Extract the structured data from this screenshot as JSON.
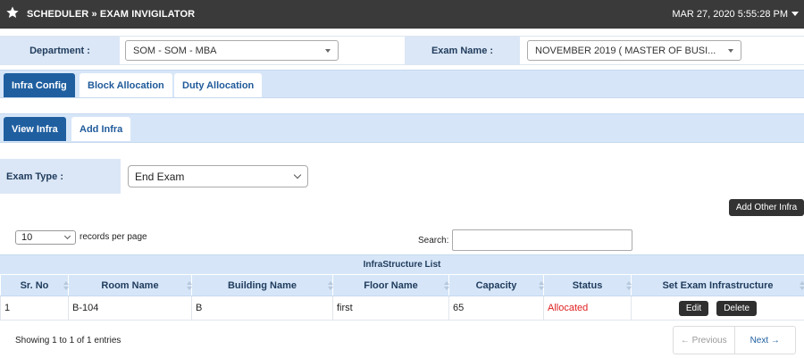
{
  "header": {
    "icon": "star-icon",
    "title": "SCHEDULER » EXAM INVIGILATOR",
    "datetime": "MAR 27, 2020   5:55:28 PM"
  },
  "filters": {
    "department_label": "Department :",
    "department_value": "SOM - SOM - MBA",
    "exam_name_label": "Exam Name :",
    "exam_name_value": "NOVEMBER 2019 ( MASTER OF BUSI..."
  },
  "main_tabs": [
    {
      "label": "Infra Config",
      "active": true
    },
    {
      "label": "Block Allocation",
      "active": false
    },
    {
      "label": "Duty Allocation",
      "active": false
    }
  ],
  "sub_tabs": [
    {
      "label": "View Infra",
      "active": true
    },
    {
      "label": "Add Infra",
      "active": false
    }
  ],
  "exam_type": {
    "label": "Exam Type :",
    "value": "End Exam"
  },
  "add_other_label": "Add Other Infra",
  "table_controls": {
    "page_length": "10",
    "page_length_suffix": "records per page",
    "search_label": "Search:",
    "search_value": ""
  },
  "table": {
    "caption": "InfraStructure List",
    "columns": [
      "Sr. No",
      "Room Name",
      "Building Name",
      "Floor Name",
      "Capacity",
      "Status",
      "Set Exam Infrastructure"
    ],
    "rows": [
      {
        "sr": "1",
        "room": "B-104",
        "building": "B",
        "floor": "first",
        "capacity": "65",
        "status": "Allocated",
        "edit": "Edit",
        "delete": "Delete"
      }
    ]
  },
  "footer": {
    "info": "Showing 1 to 1 of 1 entries",
    "prev": "← Previous",
    "next": "Next →"
  },
  "colors": {
    "topbar": "#3a3a3a",
    "accent": "#1f5fa0",
    "light_band": "#d6e6f8",
    "status_allocated": "#e02020"
  }
}
